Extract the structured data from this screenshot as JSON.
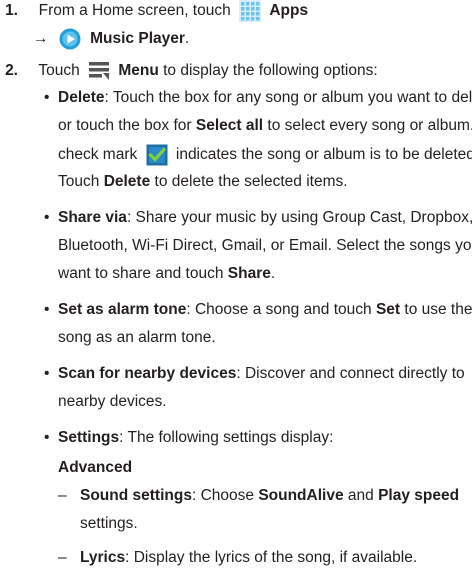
{
  "steps": [
    {
      "num": "1.",
      "line1_pre": "From a Home screen, touch",
      "apps_label": "Apps",
      "arrow": "→",
      "music_player_label": "Music Player",
      "line2_post": "."
    },
    {
      "num": "2.",
      "pre": "Touch",
      "menu_label": "Menu",
      "post": "to display the following options:"
    }
  ],
  "bullets": {
    "delete": {
      "label": "Delete",
      "l1": ": Touch the box for any song or album you want to delete",
      "l2_pre": "or touch the box for",
      "l2_bold": "Select all",
      "l2_post": "to select every song or album. A",
      "l3_pre": "check mark",
      "l3_post": "indicates the song or album is to be deleted.",
      "l4_pre": "Touch",
      "l4_bold": "Delete",
      "l4_post": "to delete the selected items."
    },
    "share": {
      "label": "Share via",
      "l1": ": Share your music by using Group Cast, Dropbox,",
      "l2": "Bluetooth, Wi-Fi Direct, Gmail, or Email. Select the songs you",
      "l3_pre": "want to share and touch",
      "l3_bold": "Share",
      "l3_post": "."
    },
    "alarm": {
      "label": "Set as alarm tone",
      "l1_pre": ": Choose a song and touch",
      "l1_bold": "Set",
      "l1_post": "to use the",
      "l2": "song as an alarm tone."
    },
    "scan": {
      "label": "Scan for nearby devices",
      "l1": ": Discover and connect directly to",
      "l2": "nearby devices."
    },
    "settings": {
      "label": "Settings",
      "l1": ": The following settings display:",
      "advanced": "Advanced",
      "sound_label": "Sound settings",
      "sound_pre": ": Choose",
      "sound_b1": "SoundAlive",
      "sound_mid": "and",
      "sound_b2": "Play speed",
      "sound_l2": "settings.",
      "lyrics_label": "Lyrics",
      "lyrics_text": ": Display the lyrics of the song, if available."
    }
  },
  "symbols": {
    "bullet": "•",
    "dash": "–"
  },
  "colors": {
    "apps_icon": "#6fc3e8",
    "music_icon": "#1f9fd6",
    "check_box": "#1f6fa3",
    "check_mark": "#7bd13f",
    "menu_icon": "#555555"
  }
}
